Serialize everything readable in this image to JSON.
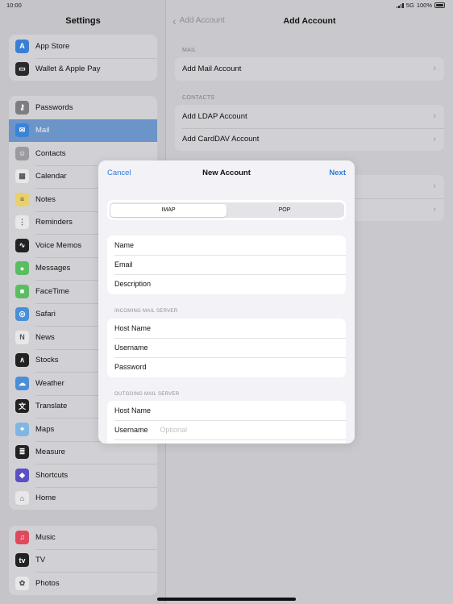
{
  "status_bar": {
    "time": "10:00",
    "network": "5G",
    "battery": "100%"
  },
  "sidebar": {
    "title": "Settings",
    "groups": [
      {
        "items": [
          {
            "label": "App Store",
            "icon": "app-store-icon",
            "color": "#3a7fd6",
            "glyph": "A"
          },
          {
            "label": "Wallet & Apple Pay",
            "icon": "wallet-icon",
            "color": "#2a2a2c",
            "glyph": "▭"
          }
        ]
      },
      {
        "items": [
          {
            "label": "Passwords",
            "icon": "key-icon",
            "color": "#7d7d82",
            "glyph": "⚷"
          },
          {
            "label": "Mail",
            "icon": "mail-icon",
            "color": "#3b83d8",
            "glyph": "✉",
            "selected": true
          },
          {
            "label": "Contacts",
            "icon": "contacts-icon",
            "color": "#9a9a9f",
            "glyph": "☺"
          },
          {
            "label": "Calendar",
            "icon": "calendar-icon",
            "color": "#e7e7ea",
            "glyph": "▦"
          },
          {
            "label": "Notes",
            "icon": "notes-icon",
            "color": "#e9d06a",
            "glyph": "≡"
          },
          {
            "label": "Reminders",
            "icon": "reminders-icon",
            "color": "#e7e7ea",
            "glyph": "⋮"
          },
          {
            "label": "Voice Memos",
            "icon": "voice-memos-icon",
            "color": "#222222",
            "glyph": "∿"
          },
          {
            "label": "Messages",
            "icon": "messages-icon",
            "color": "#5bbd62",
            "glyph": "●"
          },
          {
            "label": "FaceTime",
            "icon": "facetime-icon",
            "color": "#5bbd62",
            "glyph": "■"
          },
          {
            "label": "Safari",
            "icon": "safari-icon",
            "color": "#4a8ed8",
            "glyph": "◎"
          },
          {
            "label": "News",
            "icon": "news-icon",
            "color": "#e7e7ea",
            "glyph": "N"
          },
          {
            "label": "Stocks",
            "icon": "stocks-icon",
            "color": "#222222",
            "glyph": "∧"
          },
          {
            "label": "Weather",
            "icon": "weather-icon",
            "color": "#4a8ed8",
            "glyph": "☁"
          },
          {
            "label": "Translate",
            "icon": "translate-icon",
            "color": "#222222",
            "glyph": "文"
          },
          {
            "label": "Maps",
            "icon": "maps-icon",
            "color": "#7fb6e3",
            "glyph": "⌖"
          },
          {
            "label": "Measure",
            "icon": "measure-icon",
            "color": "#222222",
            "glyph": "≣"
          },
          {
            "label": "Shortcuts",
            "icon": "shortcuts-icon",
            "color": "#5b4fc4",
            "glyph": "◆"
          },
          {
            "label": "Home",
            "icon": "home-icon",
            "color": "#e7e7ea",
            "glyph": "⌂"
          }
        ]
      },
      {
        "items": [
          {
            "label": "Music",
            "icon": "music-icon",
            "color": "#e0485c",
            "glyph": "♫"
          },
          {
            "label": "TV",
            "icon": "tv-icon",
            "color": "#222222",
            "glyph": "tv"
          },
          {
            "label": "Photos",
            "icon": "photos-icon",
            "color": "#e7e7ea",
            "glyph": "✿"
          }
        ]
      }
    ]
  },
  "detail": {
    "back_label": "Add Account",
    "title": "Add Account",
    "sections": [
      {
        "header": "MAIL",
        "rows": [
          "Add Mail Account"
        ]
      },
      {
        "header": "CONTACTS",
        "rows": [
          "Add LDAP Account",
          "Add CardDAV Account"
        ]
      },
      {
        "header": "",
        "rows": [
          "",
          ""
        ]
      }
    ]
  },
  "modal": {
    "cancel_label": "Cancel",
    "title": "New Account",
    "next_label": "Next",
    "segments": [
      {
        "label": "IMAP",
        "active": true
      },
      {
        "label": "POP",
        "active": false
      }
    ],
    "account_fields": [
      "Name",
      "Email",
      "Description"
    ],
    "incoming_header": "INCOMING MAIL SERVER",
    "incoming_fields": [
      "Host Name",
      "Username",
      "Password"
    ],
    "outgoing_header": "OUTGOING MAIL SERVER",
    "outgoing_fields": [
      {
        "label": "Host Name",
        "placeholder": ""
      },
      {
        "label": "Username",
        "placeholder": "Optional"
      }
    ]
  }
}
